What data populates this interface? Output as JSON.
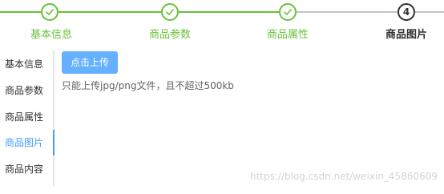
{
  "steps": [
    {
      "title": "基本信息",
      "status": "done"
    },
    {
      "title": "商品参数",
      "status": "done"
    },
    {
      "title": "商品属性",
      "status": "done"
    },
    {
      "title": "商品图片",
      "status": "current",
      "number": "4"
    }
  ],
  "tabs": [
    {
      "label": "基本信息"
    },
    {
      "label": "商品参数"
    },
    {
      "label": "商品属性"
    },
    {
      "label": "商品图片",
      "active": true
    },
    {
      "label": "商品内容"
    }
  ],
  "upload": {
    "button_label": "点击上传",
    "tip": "只能上传jpg/png文件，且不超过500kb"
  },
  "watermark": "https://blog.csdn.net/weixin_45860609",
  "colors": {
    "success": "#67c23a",
    "primary": "#409eff",
    "primary_light": "#66b1ff",
    "text": "#303133",
    "muted": "#c0c4cc"
  }
}
